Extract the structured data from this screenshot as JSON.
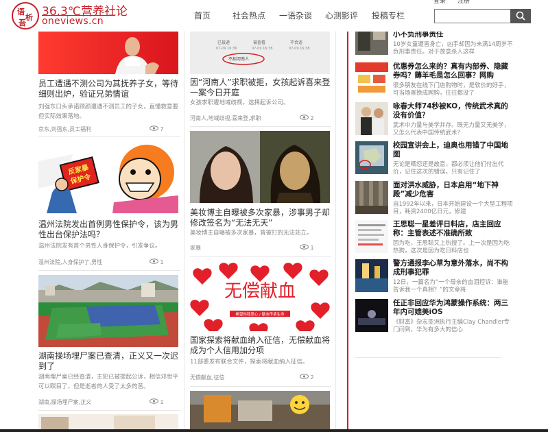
{
  "site": {
    "logo_glyphs": [
      "语",
      "析",
      "吾"
    ],
    "name_cn": "36.3℃营养社论",
    "name_en": "oneviews.cn"
  },
  "nav": {
    "items": [
      "首页",
      "社会热点",
      "一语杂谈",
      "心测影评",
      "投稿专栏"
    ],
    "login": "登录",
    "register": "注册",
    "search_placeholder": ""
  },
  "col_left": [
    {
      "title": "员工遭遇不测公司为其抚养子女，等待细则出炉，验证兄弟情谊",
      "desc": "刘强东口头承诺顾颜遭遇不测员工的子女，直懂救意要但实际效果落地。",
      "tags": "京东,刘强东,员工福利",
      "views": "7"
    },
    {
      "title": "温州法院发出首例男性保护令，该为男性出台保护法吗？",
      "desc": "温州法院发有首个男性人身保护令，引发争议。",
      "tags": "温州法院,人身保护了,男性",
      "views": "1",
      "img_text": "反家暴保护令"
    },
    {
      "title": "湖南操场埋尸案已查清，正义又一次迟到了",
      "desc": "湖南埋尸案已经查清，主犯已被提起公诉，相信邓世平可以瞑目了，但是逝者的人受了太多的苦。",
      "tags": "湖南,操场埋尸案,正义",
      "views": "1"
    }
  ],
  "col_mid": [
    {
      "title": "因“河南人”求职被拒，女孩起诉喜来登一案今日开庭",
      "desc": "女孩求职遭地域歧视，选择起诉公司。",
      "tags": "河南人,地域歧视,喜来登,求职",
      "views": "2"
    },
    {
      "title": "美妆博主自曝被多次家暴，涉事男子却修改签名为“无法无天”",
      "desc": "美妆博主自曝被多次家暴，曾被打的无法站立。",
      "tags": "家暴",
      "views": "1"
    },
    {
      "title": "国家探索将献血纳入征信，无偿献血将成为个人信用加分项",
      "desc": "11部委发布联合文件，探索将献血纳入征信。",
      "tags": "无偿献血,征信",
      "views": "2",
      "img_big": "无偿献血",
      "img_small": "希望你我爱心 / 献血传承生命"
    }
  ],
  "right_list": [
    {
      "title": "小不负刑事责任",
      "desc": "10岁女童遭害身亡，凶手却因为未满14周岁不负刑事责任。对于故意杀人这样"
    },
    {
      "title": "优惠券怎么来的？真有内部券、隐藏券吗？薅羊毛是怎么回事？网购",
      "desc": "很多朋友在线下门店购物时，是软价的好手，可当场景换成网购，往往都没了"
    },
    {
      "title": "咏春大师74秒被KO，传统武术真的没有价值？",
      "desc": "武术中力量与美学并存。既无力量又无美学，又怎么代表中国传统武术？"
    },
    {
      "title": "校园宣讲会上，迪奥也用错了中国地图",
      "desc": "无论是晒您还是故意，都必须让他们付出代价，记住这次的错误，只有记住了"
    },
    {
      "title": "面对洪水威胁，日本启用“地下神殿”减少危害",
      "desc": "自1992年以来，日本开始建设一个大型工程项目，耗资2400亿日元，修建"
    },
    {
      "title": "王思聪一星差评日料店，店主回应称：主管表述不准确所致",
      "desc": "因为吃，王思聪又上热搜了。上一次是因为吃热狗，这次是因为吃日料店也"
    },
    {
      "title": "警方通报李心草为意外落水，尚不构成刑事犯罪",
      "desc": "12日，一篇名为“一个母亲的血泪控诉：谁能告诉我一个真相？”的文章将"
    },
    {
      "title": "任正非回应华为鸿蒙操作系统：两三年内可媲美iOS",
      "desc": "《财富》杂志亚洲执行主编Clay Chandler专门问到，华为有多大的信心"
    }
  ],
  "colors": {
    "brand_red": "#c6202a",
    "text": "#333333",
    "muted": "#888888"
  },
  "icons": [
    "search-icon",
    "eye-icon"
  ]
}
